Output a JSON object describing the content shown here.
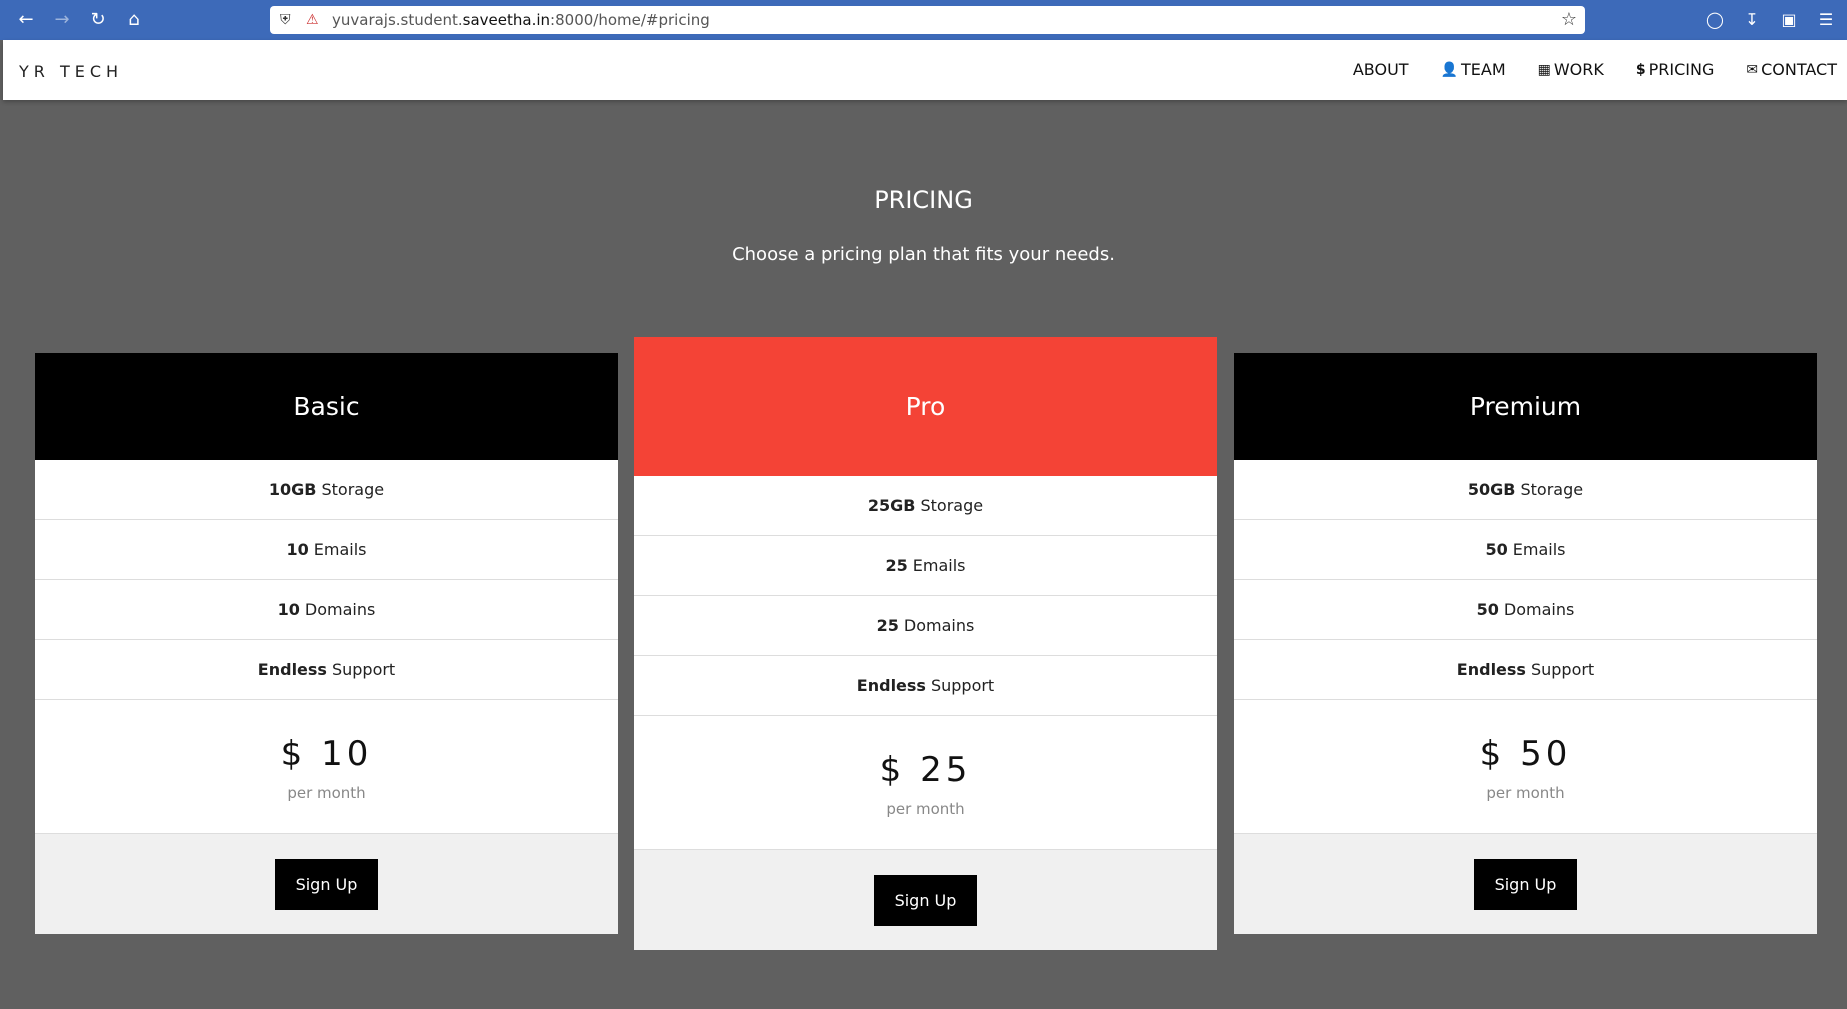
{
  "browser": {
    "url_prefix": "yuvarajs.student.",
    "url_host": "saveetha.in",
    "url_suffix": ":8000/home/#pricing"
  },
  "header": {
    "brand": "YR TECH",
    "nav": [
      {
        "label": "ABOUT",
        "icon": ""
      },
      {
        "label": "TEAM",
        "icon": "user-icon"
      },
      {
        "label": "WORK",
        "icon": "grid-icon"
      },
      {
        "label": "PRICING",
        "icon": "dollar-icon"
      },
      {
        "label": "CONTACT",
        "icon": "envelope-icon"
      }
    ]
  },
  "section": {
    "title": "PRICING",
    "subtitle": "Choose a pricing plan that fits your needs."
  },
  "plans": [
    {
      "name": "Basic",
      "features": [
        {
          "bold": "10GB",
          "text": "Storage"
        },
        {
          "bold": "10",
          "text": "Emails"
        },
        {
          "bold": "10",
          "text": "Domains"
        },
        {
          "bold": "Endless",
          "text": "Support"
        }
      ],
      "price": "$ 10",
      "period": "per month",
      "button": "Sign Up",
      "head_color": "#000000"
    },
    {
      "name": "Pro",
      "features": [
        {
          "bold": "25GB",
          "text": "Storage"
        },
        {
          "bold": "25",
          "text": "Emails"
        },
        {
          "bold": "25",
          "text": "Domains"
        },
        {
          "bold": "Endless",
          "text": "Support"
        }
      ],
      "price": "$ 25",
      "period": "per month",
      "button": "Sign Up",
      "head_color": "#f44336"
    },
    {
      "name": "Premium",
      "features": [
        {
          "bold": "50GB",
          "text": "Storage"
        },
        {
          "bold": "50",
          "text": "Emails"
        },
        {
          "bold": "50",
          "text": "Domains"
        },
        {
          "bold": "Endless",
          "text": "Support"
        }
      ],
      "price": "$ 50",
      "period": "per month",
      "button": "Sign Up",
      "head_color": "#000000"
    }
  ]
}
